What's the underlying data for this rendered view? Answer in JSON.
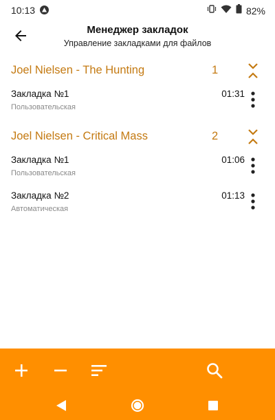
{
  "status": {
    "time": "10:13",
    "battery": "82%"
  },
  "header": {
    "title": "Менеджер закладок",
    "subtitle": "Управление закладками для файлов"
  },
  "groups": [
    {
      "title": "Joel Nielsen - The Hunting",
      "count": "1",
      "bookmarks": [
        {
          "name": "Закладка №1",
          "type": "Пользовательская",
          "time": "01:31"
        }
      ]
    },
    {
      "title": "Joel Nielsen - Critical Mass",
      "count": "2",
      "bookmarks": [
        {
          "name": "Закладка №1",
          "type": "Пользовательская",
          "time": "01:06"
        },
        {
          "name": "Закладка №2",
          "type": "Автоматическая",
          "time": "01:13"
        }
      ]
    }
  ],
  "colors": {
    "accent": "#ff8f00",
    "group_text": "#c47a12"
  },
  "toolbar_icons": [
    "plus-icon",
    "minus-icon",
    "sort-icon",
    "search-icon"
  ],
  "nav_icons": [
    "back-triangle-icon",
    "home-circle-icon",
    "recents-square-icon"
  ]
}
